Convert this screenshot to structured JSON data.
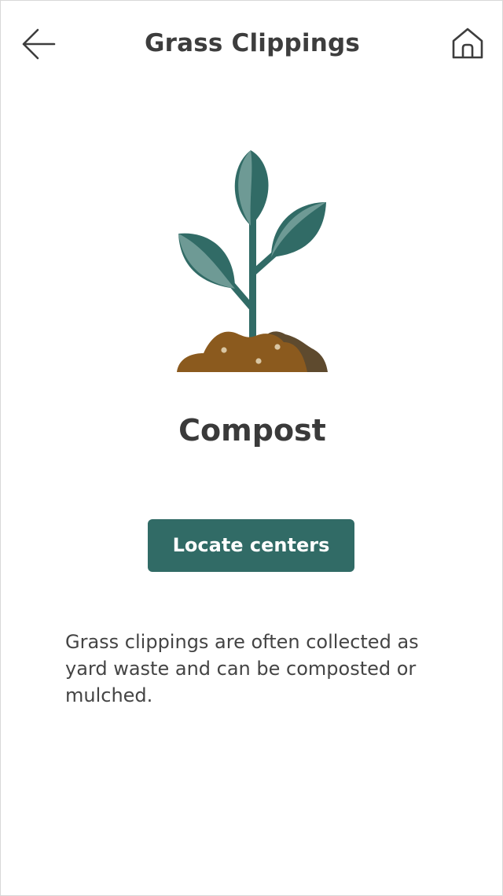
{
  "header": {
    "title": "Grass Clippings",
    "back_icon": "arrow-left-icon",
    "home_icon": "home-icon"
  },
  "item": {
    "illustration": "plant-sprout-icon",
    "category": "Compost",
    "action_label": "Locate centers",
    "description": "Grass clippings are often collected as yard waste and can be composted or mulched."
  },
  "colors": {
    "accent": "#316b66",
    "leaf_light": "#6e9a95",
    "soil": "#8b5a1e",
    "soil_dark": "#5e4a2e",
    "text": "#3d3d3d"
  }
}
